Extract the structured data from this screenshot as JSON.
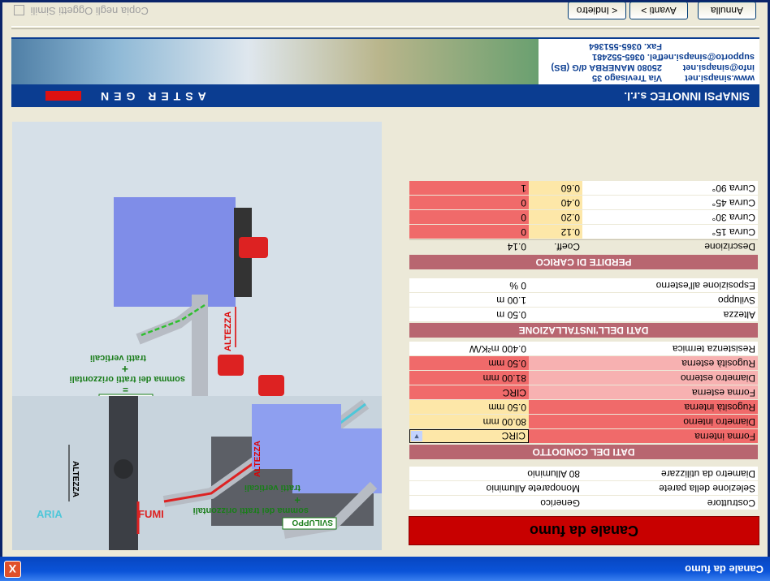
{
  "window": {
    "title": "Canale da fumo",
    "close_label": "X"
  },
  "banner": {
    "section_title": "Canale da fumo",
    "brand": "ASTER GEN",
    "company": "SINAPSI INNOTEC s.r.l.",
    "website": "www.sinapsi.net",
    "info_email": "info@sinapsi.net",
    "support_email": "supporto@sinapsi.net",
    "address": "Via Trevisago 35",
    "city": "25080 MANERBA d/G (BS)",
    "phone": "Tel. 0365-552481",
    "fax": "Fax. 0365-551364"
  },
  "general": [
    {
      "label": "Costruttore",
      "value": "Generico"
    },
    {
      "label": "Selezione della parete",
      "value": "Monoparete Alluminio"
    },
    {
      "label": "Diametro da utilizzare",
      "value": "80 Alluminio"
    }
  ],
  "sections": {
    "conduit": "DATI DEL CONDOTTO",
    "installation": "DATI DELL'INSTALLAZIONE",
    "losses": "PERDITE DI CARICO"
  },
  "conduit": [
    {
      "label": "Forma interna",
      "value": "CIRC",
      "select": true
    },
    {
      "label": "Diametro interno",
      "value": "80.00 mm"
    },
    {
      "label": "Rugosità interna",
      "value": "0.50 mm"
    },
    {
      "label": "Forma esterna",
      "value": "CIRC"
    },
    {
      "label": "Diametro esterno",
      "value": "81.00 mm"
    },
    {
      "label": "Rugosità esterna",
      "value": "0.50 mm"
    },
    {
      "label": "Resistenza termica",
      "value": "0.400 m²K/W"
    }
  ],
  "installation": [
    {
      "label": "Altezza",
      "value": "0.50 m"
    },
    {
      "label": "Sviluppo",
      "value": "1.00 m"
    },
    {
      "label": "Esposizione all'esterno",
      "value": "0 %"
    }
  ],
  "losses": {
    "header": {
      "label": "Descrizione",
      "coeff": "Coeff.",
      "value": "0.14"
    },
    "rows": [
      {
        "label": "Curva 15°",
        "coeff": "0.12",
        "value": "0"
      },
      {
        "label": "Curva 30°",
        "coeff": "0.20",
        "value": "0"
      },
      {
        "label": "Curva 45°",
        "coeff": "0.40",
        "value": "0"
      },
      {
        "label": "Curva 90°",
        "coeff": "0.60",
        "value": "1"
      }
    ]
  },
  "diagram": {
    "top_altezza": "ALTEZZA",
    "sviluppo": "SVILUPPO",
    "equals": "=",
    "sum_text": "somma dei tratti orizzontali",
    "plus": "+",
    "vert_text": "tratti verticali",
    "aria": "ARIA",
    "fumi": "FUMI",
    "altezza": "ALTEZZA",
    "right_altezza": "ALTEZZA",
    "r_sviluppo": "SVILUPPO",
    "r_sum_text": "somma dei tratti orizzontali",
    "r_plus": "+",
    "r_vert_text": "tratti verticali"
  },
  "footer": {
    "copy_label": "Copia negli Oggetti Simili",
    "back_label": "< Indietro",
    "next_label": "Avanti >",
    "cancel_label": "Annulla"
  }
}
